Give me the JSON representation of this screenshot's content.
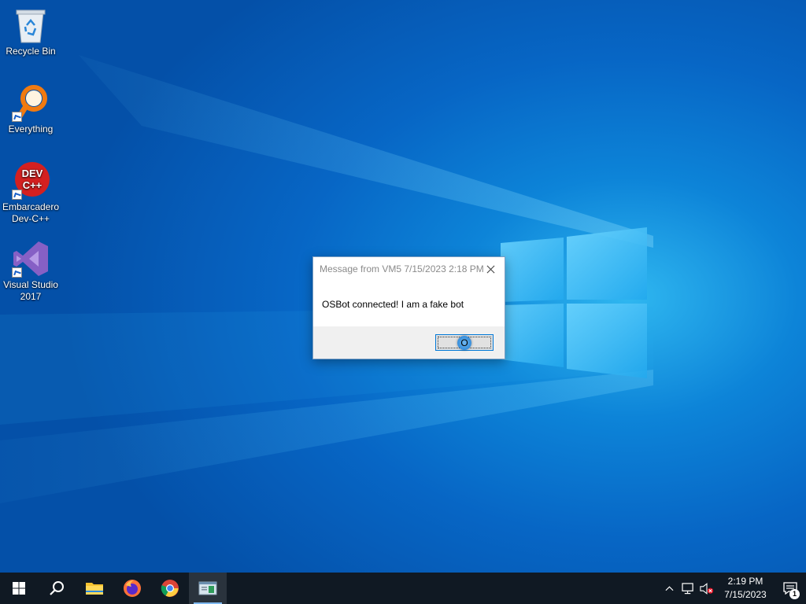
{
  "desktop": {
    "icons": [
      {
        "label": "Recycle Bin",
        "icon": "recycle-bin-icon"
      },
      {
        "label": "Everything",
        "icon": "everything-search-icon"
      },
      {
        "label": "Embarcadero Dev-C++",
        "icon": "dev-cpp-icon",
        "logo_text": "DEV C++"
      },
      {
        "label": "Visual Studio 2017",
        "icon": "visual-studio-icon"
      }
    ]
  },
  "dialog": {
    "title": "Message from VM5 7/15/2023 2:18 PM",
    "message": "OSBot connected! I am a fake bot",
    "ok_label": "O",
    "close_icon": "close-icon"
  },
  "taskbar": {
    "items": [
      {
        "icon": "windows-start-icon"
      },
      {
        "icon": "search-icon"
      },
      {
        "icon": "file-explorer-icon"
      },
      {
        "icon": "firefox-icon"
      },
      {
        "icon": "chrome-icon"
      },
      {
        "icon": "remote-app-icon",
        "active": true
      }
    ],
    "tray": {
      "chevron_icon": "chevron-up-icon",
      "network_icon": "network-icon",
      "volume_icon": "volume-muted-icon",
      "time": "2:19 PM",
      "date": "7/15/2023",
      "notification_count": "1"
    }
  },
  "colors": {
    "taskbar_bg": "#101923",
    "desktop_accent": "#0766c5",
    "focus_border": "#0078d7"
  }
}
